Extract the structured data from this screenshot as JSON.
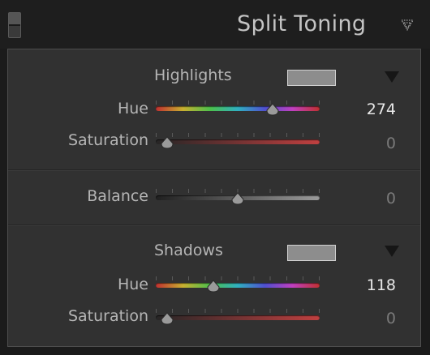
{
  "panel": {
    "title": "Split Toning"
  },
  "highlights": {
    "heading": "Highlights",
    "swatch_color": "#8d8d8d",
    "hue": {
      "label": "Hue",
      "value": "274",
      "position": 0.745
    },
    "saturation": {
      "label": "Saturation",
      "value": "0",
      "position": 0.0
    }
  },
  "balance": {
    "label": "Balance",
    "value": "0",
    "position": 0.5
  },
  "shadows": {
    "heading": "Shadows",
    "swatch_color": "#8d8d8d",
    "hue": {
      "label": "Hue",
      "value": "118",
      "position": 0.33
    },
    "saturation": {
      "label": "Saturation",
      "value": "0",
      "position": 0.0
    }
  },
  "icons": {
    "panel_toggle": "panel-toggle-icon",
    "collapse": "collapse-triangle-icon",
    "disclosure": "disclosure-triangle-icon"
  },
  "colors": {
    "background": "#1b1b1b",
    "panel": "#313131",
    "hue_gradient": [
      "#c03030",
      "#c8b030",
      "#4cc04c",
      "#30b0c0",
      "#5050d0",
      "#c040c0",
      "#c03030"
    ],
    "saturation_gradient": [
      "#262626",
      "#c04040"
    ],
    "balance_gradient": [
      "#202020",
      "#9a9a9a"
    ]
  }
}
